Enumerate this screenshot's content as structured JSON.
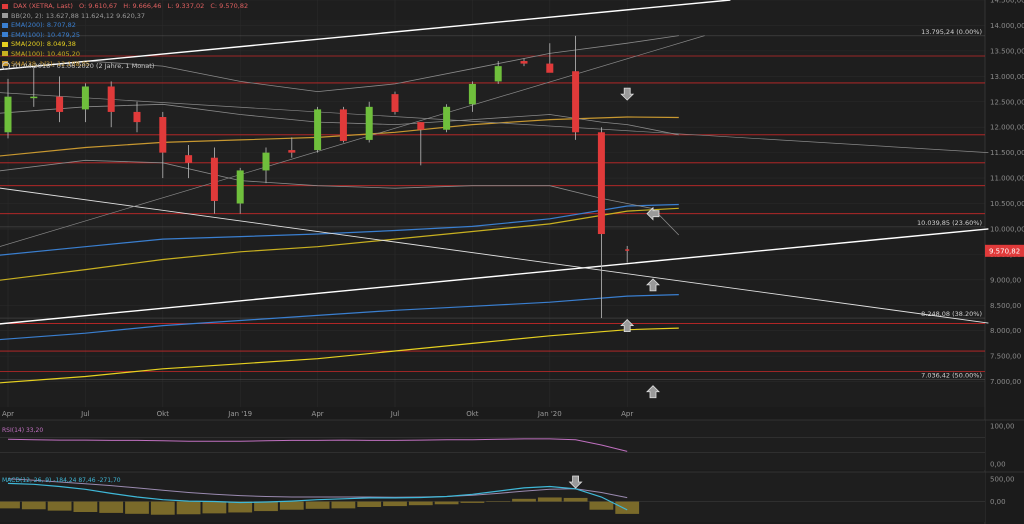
{
  "title": "DAX (XETRA, Last)",
  "ohlc": {
    "o": "O: 9.610,67",
    "h": "H: 9.666,46",
    "l": "L: 9.337,02",
    "c": "C: 9.570,82"
  },
  "indicators": [
    {
      "label": "BB(20, 2)",
      "value": "13.627,88  11.624,12  9.620,37",
      "color": "#9a9a9a"
    },
    {
      "label": "EMA(200)",
      "value": "8.707,82",
      "color": "#3a7fd0"
    },
    {
      "label": "EMA(100)",
      "value": "10.479,25",
      "color": "#3a7fd0"
    },
    {
      "label": "SMA(200)",
      "value": "8.049,38",
      "color": "#e6d020"
    },
    {
      "label": "SMA(100)",
      "value": "10.405,20",
      "color": "#c8b020"
    },
    {
      "label": "SMA(38, hl2)",
      "value": "12.188,85",
      "color": "#c89830"
    }
  ],
  "range_label": "01.04.2018 - 01.06.2020 (2 Jahre, 1 Monat)",
  "last_price_label": "9.570,82",
  "fib_labels": [
    {
      "text": "13.795,24 (0.00%)",
      "value": 13795.24
    },
    {
      "text": "10.039,85 (23.60%)",
      "value": 10039.85
    },
    {
      "text": "8.248,08 (38.20%)",
      "value": 8248.08
    },
    {
      "text": "7.036,42 (50.00%)",
      "value": 7036.42
    }
  ],
  "rsi_label": "RSI(14)  33,20",
  "macd_label": "MACD(12, 26, 9)  -184,24  87,46  -271,70",
  "colors": {
    "up": "#6fbf3c",
    "down": "#e03a3a",
    "resistance": "#c62828",
    "bg": "#1b1b1b",
    "grid": "#2a2a2a"
  },
  "chart_data": {
    "type": "candlestick",
    "title": "DAX (XETRA, Last)",
    "ylim": [
      6500,
      14500
    ],
    "y_ticks": [
      "7.000,00",
      "7.500,00",
      "8.000,00",
      "8.500,00",
      "9.000,00",
      "9.500,00",
      "10.000,00",
      "10.500,00",
      "11.000,00",
      "11.500,00",
      "12.000,00",
      "12.500,00",
      "13.000,00",
      "13.500,00",
      "14.000,00",
      "14.500,00"
    ],
    "x_ticks": [
      {
        "label": "Apr",
        "index": 0
      },
      {
        "label": "Jul",
        "index": 3
      },
      {
        "label": "Okt",
        "index": 6
      },
      {
        "label": "Jan '19",
        "index": 9
      },
      {
        "label": "Apr",
        "index": 12
      },
      {
        "label": "Jul",
        "index": 15
      },
      {
        "label": "Okt",
        "index": 18
      },
      {
        "label": "Jan '20",
        "index": 21
      },
      {
        "label": "Apr",
        "index": 24
      }
    ],
    "candles": [
      {
        "o": 11900,
        "h": 12950,
        "l": 11780,
        "c": 12600
      },
      {
        "o": 12600,
        "h": 13200,
        "l": 12400,
        "c": 12600
      },
      {
        "o": 12600,
        "h": 13000,
        "l": 12100,
        "c": 12300
      },
      {
        "o": 12350,
        "h": 12860,
        "l": 12100,
        "c": 12800
      },
      {
        "o": 12800,
        "h": 12900,
        "l": 12000,
        "c": 12300
      },
      {
        "o": 12300,
        "h": 12500,
        "l": 11900,
        "c": 12100
      },
      {
        "o": 12200,
        "h": 12300,
        "l": 11000,
        "c": 11500
      },
      {
        "o": 11450,
        "h": 11650,
        "l": 11000,
        "c": 11300
      },
      {
        "o": 11400,
        "h": 11600,
        "l": 10300,
        "c": 10550
      },
      {
        "o": 10500,
        "h": 11200,
        "l": 10300,
        "c": 11150
      },
      {
        "o": 11150,
        "h": 11600,
        "l": 10900,
        "c": 11500
      },
      {
        "o": 11550,
        "h": 11800,
        "l": 11400,
        "c": 11500
      },
      {
        "o": 11550,
        "h": 12400,
        "l": 11500,
        "c": 12350
      },
      {
        "o": 12350,
        "h": 12400,
        "l": 11700,
        "c": 11730
      },
      {
        "o": 11750,
        "h": 12500,
        "l": 11700,
        "c": 12400
      },
      {
        "o": 12650,
        "h": 12700,
        "l": 12250,
        "c": 12300
      },
      {
        "o": 12100,
        "h": 12100,
        "l": 11250,
        "c": 11950
      },
      {
        "o": 11950,
        "h": 12450,
        "l": 11900,
        "c": 12400
      },
      {
        "o": 12450,
        "h": 12900,
        "l": 12300,
        "c": 12850
      },
      {
        "o": 12900,
        "h": 13300,
        "l": 12850,
        "c": 13200
      },
      {
        "o": 13300,
        "h": 13350,
        "l": 13200,
        "c": 13250
      },
      {
        "o": 13250,
        "h": 13650,
        "l": 13100,
        "c": 13070
      },
      {
        "o": 13100,
        "h": 13795,
        "l": 11750,
        "c": 11900
      },
      {
        "o": 11900,
        "h": 12000,
        "l": 8250,
        "c": 9900
      },
      {
        "o": 9600,
        "h": 9666,
        "l": 9337,
        "c": 9570
      }
    ],
    "resistance_lines": [
      13400,
      12870,
      11850,
      11300,
      10850,
      10300,
      8140,
      7600,
      7200
    ],
    "trend_lines": [
      {
        "from": {
          "index": -1,
          "value": 13100
        },
        "to": {
          "index": 28,
          "value": 14500
        },
        "color": "#ffffff",
        "width": 1.4
      },
      {
        "from": {
          "index": -1,
          "value": 8100
        },
        "to": {
          "index": 38,
          "value": 10000
        },
        "color": "#ffffff",
        "width": 1.4
      },
      {
        "from": {
          "index": -1,
          "value": 10850
        },
        "to": {
          "index": 38,
          "value": 8150
        },
        "color": "#e0e0e0",
        "width": 0.9
      },
      {
        "from": {
          "index": -1,
          "value": 9550
        },
        "to": {
          "index": 27,
          "value": 13800
        },
        "color": "#888888",
        "width": 0.7
      },
      {
        "from": {
          "index": -1,
          "value": 12700
        },
        "to": {
          "index": 38,
          "value": 11500
        },
        "color": "#888888",
        "width": 0.7
      }
    ],
    "series": [
      {
        "name": "EMA(200)",
        "color": "#3a7fd0",
        "points": [
          [
            -1,
            7800
          ],
          [
            3,
            7950
          ],
          [
            6,
            8100
          ],
          [
            9,
            8200
          ],
          [
            12,
            8300
          ],
          [
            15,
            8400
          ],
          [
            18,
            8480
          ],
          [
            21,
            8560
          ],
          [
            24,
            8680
          ],
          [
            26,
            8710
          ]
        ]
      },
      {
        "name": "SMA(200)",
        "color": "#e6d020",
        "points": [
          [
            -1,
            6950
          ],
          [
            3,
            7100
          ],
          [
            6,
            7250
          ],
          [
            9,
            7350
          ],
          [
            12,
            7450
          ],
          [
            15,
            7600
          ],
          [
            18,
            7750
          ],
          [
            21,
            7900
          ],
          [
            24,
            8020
          ],
          [
            26,
            8050
          ]
        ]
      },
      {
        "name": "EMA(100)",
        "color": "#3a7fd0",
        "points": [
          [
            -1,
            9450
          ],
          [
            3,
            9650
          ],
          [
            6,
            9800
          ],
          [
            9,
            9850
          ],
          [
            12,
            9900
          ],
          [
            15,
            9970
          ],
          [
            18,
            10050
          ],
          [
            21,
            10200
          ],
          [
            24,
            10450
          ],
          [
            26,
            10480
          ]
        ]
      },
      {
        "name": "SMA(100)",
        "color": "#c8b020",
        "points": [
          [
            -1,
            8950
          ],
          [
            3,
            9200
          ],
          [
            6,
            9400
          ],
          [
            9,
            9550
          ],
          [
            12,
            9650
          ],
          [
            15,
            9800
          ],
          [
            18,
            9950
          ],
          [
            21,
            10100
          ],
          [
            24,
            10350
          ],
          [
            26,
            10405
          ]
        ]
      },
      {
        "name": "SMA(38, hl2)",
        "color": "#c89830",
        "points": [
          [
            -1,
            11400
          ],
          [
            3,
            11600
          ],
          [
            6,
            11700
          ],
          [
            9,
            11750
          ],
          [
            12,
            11800
          ],
          [
            15,
            11900
          ],
          [
            18,
            12050
          ],
          [
            21,
            12150
          ],
          [
            24,
            12200
          ],
          [
            26,
            12190
          ]
        ]
      },
      {
        "name": "BB upper",
        "color": "#8a8a8a",
        "points": [
          [
            -1,
            13100
          ],
          [
            3,
            13300
          ],
          [
            6,
            13200
          ],
          [
            9,
            12900
          ],
          [
            12,
            12700
          ],
          [
            15,
            12850
          ],
          [
            18,
            13150
          ],
          [
            21,
            13450
          ],
          [
            24,
            13650
          ],
          [
            26,
            13800
          ]
        ]
      },
      {
        "name": "BB middle",
        "color": "#8a8a8a",
        "points": [
          [
            -1,
            12250
          ],
          [
            3,
            12400
          ],
          [
            6,
            12450
          ],
          [
            9,
            12250
          ],
          [
            12,
            12100
          ],
          [
            15,
            12050
          ],
          [
            18,
            12150
          ],
          [
            21,
            12250
          ],
          [
            23,
            12100
          ],
          [
            24,
            12050
          ],
          [
            26,
            11850
          ]
        ]
      },
      {
        "name": "BB lower",
        "color": "#8a8a8a",
        "points": [
          [
            -1,
            11100
          ],
          [
            3,
            11350
          ],
          [
            6,
            11300
          ],
          [
            9,
            10950
          ],
          [
            12,
            10850
          ],
          [
            15,
            10800
          ],
          [
            18,
            10850
          ],
          [
            21,
            10850
          ],
          [
            23,
            10600
          ],
          [
            25,
            10400
          ],
          [
            26,
            9880
          ]
        ]
      }
    ],
    "arrows": [
      {
        "index": 24,
        "value": 12650,
        "dir": "down"
      },
      {
        "index": 25,
        "value": 10300,
        "dir": "left"
      },
      {
        "index": 25,
        "value": 8900,
        "dir": "up"
      },
      {
        "index": 24,
        "value": 8100,
        "dir": "up"
      },
      {
        "index": 25,
        "value": 6800,
        "dir": "up"
      }
    ],
    "rsi": {
      "ylim": [
        0,
        100
      ],
      "ticks": [
        "100,00",
        "0,00"
      ],
      "values": [
        65,
        64,
        63,
        63,
        62,
        62,
        61,
        60,
        60,
        60,
        61,
        62,
        62,
        63,
        62,
        62,
        63,
        64,
        64,
        65,
        66,
        66,
        64,
        50,
        33.2
      ]
    },
    "macd": {
      "ylim": [
        -450,
        650
      ],
      "ticks": [
        "500,00",
        "0,00"
      ],
      "histogram": [
        -150,
        -170,
        -200,
        -230,
        -250,
        -270,
        -290,
        -280,
        -260,
        -240,
        -210,
        -180,
        -160,
        -150,
        -120,
        -100,
        -80,
        -60,
        -30,
        10,
        60,
        90,
        80,
        -180,
        -271.7
      ],
      "macd": [
        400,
        380,
        330,
        270,
        180,
        100,
        40,
        10,
        0,
        -20,
        -10,
        10,
        40,
        60,
        80,
        80,
        90,
        110,
        160,
        230,
        300,
        330,
        280,
        100,
        -184.24
      ],
      "signal": [
        500,
        470,
        430,
        390,
        350,
        300,
        250,
        200,
        160,
        130,
        110,
        100,
        100,
        100,
        100,
        95,
        100,
        110,
        140,
        180,
        230,
        270,
        280,
        200,
        87.46
      ]
    }
  }
}
